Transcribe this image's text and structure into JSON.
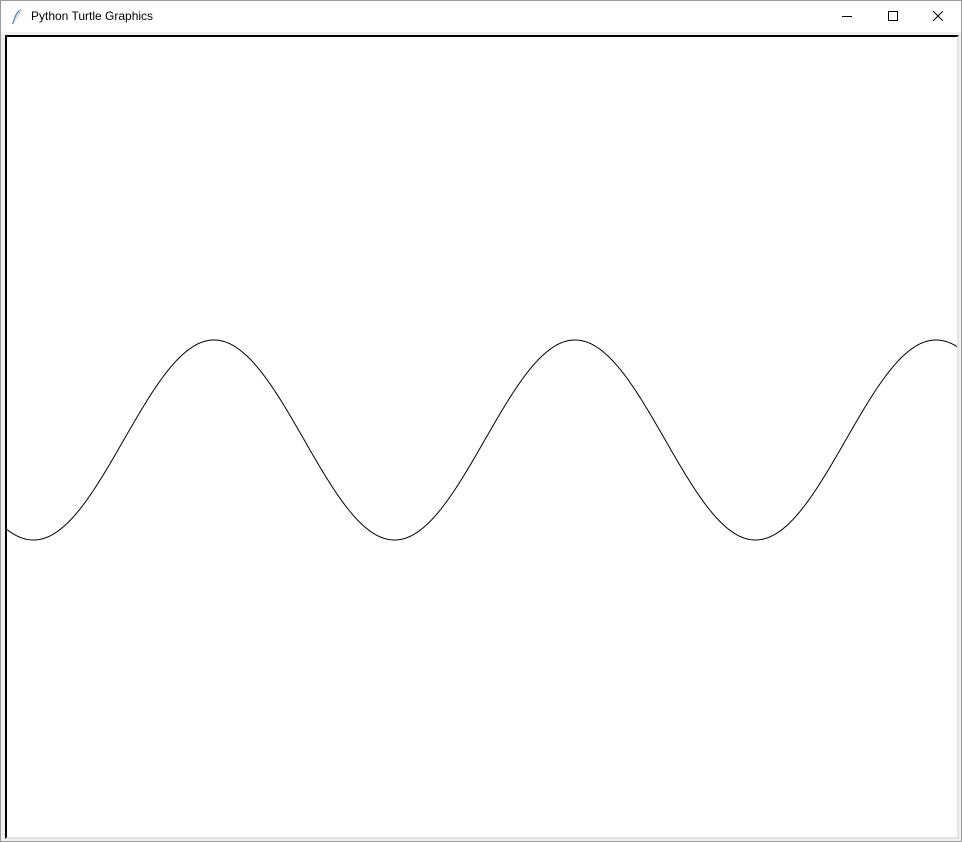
{
  "window": {
    "title": "Python Turtle Graphics",
    "icon": "feather-icon",
    "controls": {
      "minimize_icon": "minimize-icon",
      "maximize_icon": "maximize-icon",
      "close_icon": "close-icon"
    }
  },
  "canvas": {
    "background": "#ffffff",
    "pen_color": "#000000",
    "drawing": "sine-wave"
  }
}
